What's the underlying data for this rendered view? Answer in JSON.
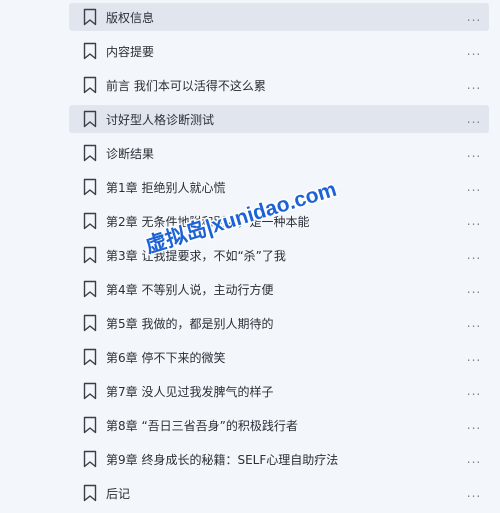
{
  "outline": {
    "items": [
      {
        "label": "版权信息",
        "highlighted": true
      },
      {
        "label": "内容提要",
        "highlighted": false
      },
      {
        "label": "前言 我们本可以活得不这么累",
        "highlighted": false
      },
      {
        "label": "讨好型人格诊断测试",
        "highlighted": true
      },
      {
        "label": "诊断结果",
        "highlighted": false
      },
      {
        "label": "第1章 拒绝别人就心慌",
        "highlighted": false
      },
      {
        "label": "第2章 无条件地附和别人，是一种本能",
        "highlighted": false
      },
      {
        "label": "第3章 让我提要求，不如“杀”了我",
        "highlighted": false
      },
      {
        "label": "第4章 不等别人说，主动行方便",
        "highlighted": false
      },
      {
        "label": "第5章 我做的，都是别人期待的",
        "highlighted": false
      },
      {
        "label": "第6章 停不下来的微笑",
        "highlighted": false
      },
      {
        "label": "第7章 没人见过我发脾气的样子",
        "highlighted": false
      },
      {
        "label": "第8章 “吾日三省吾身”的积极践行者",
        "highlighted": false
      },
      {
        "label": "第9章 终身成长的秘籍：SELF心理自助疗法",
        "highlighted": false
      },
      {
        "label": "后记",
        "highlighted": false
      }
    ],
    "more_glyph": "..."
  },
  "watermark": {
    "text": "虚拟岛|xunidao.com",
    "color": "#1e63d6"
  },
  "icons": {
    "bookmark": "bookmark-icon",
    "more": "more-options-icon"
  }
}
